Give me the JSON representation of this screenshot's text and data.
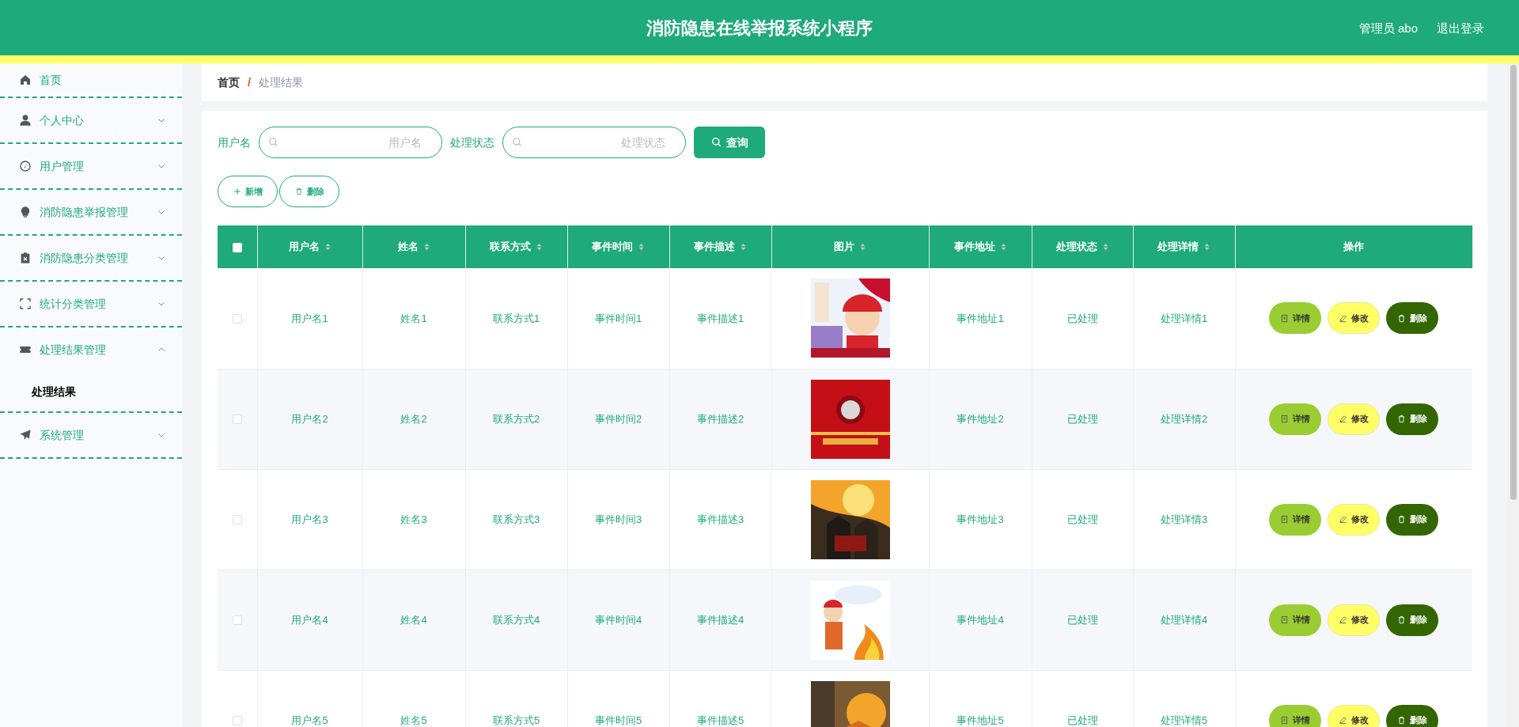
{
  "header": {
    "title": "消防隐患在线举报系统小程序",
    "user": "管理员 abo",
    "logout": "退出登录"
  },
  "sidebar": {
    "items": [
      {
        "label": "首页"
      },
      {
        "label": "个人中心",
        "expanded": false
      },
      {
        "label": "用户管理",
        "expanded": false
      },
      {
        "label": "消防隐患举报管理",
        "expanded": false
      },
      {
        "label": "消防隐患分类管理",
        "expanded": false
      },
      {
        "label": "统计分类管理",
        "expanded": false
      },
      {
        "label": "处理结果管理",
        "expanded": true,
        "children": [
          {
            "label": "处理结果",
            "selected": true
          }
        ]
      },
      {
        "label": "系统管理",
        "expanded": false
      }
    ]
  },
  "breadcrumb": {
    "items": [
      "首页",
      "处理结果"
    ],
    "separator": "/"
  },
  "search": {
    "fields": [
      {
        "label": "用户名",
        "placeholder": "用户名"
      },
      {
        "label": "处理状态",
        "placeholder": "处理状态"
      }
    ],
    "button": "查询"
  },
  "actions": [
    {
      "kind": "add",
      "label": "新增"
    },
    {
      "kind": "delete",
      "label": "删除"
    }
  ],
  "table": {
    "select_all": {
      "checked": false
    },
    "columns": [
      {
        "label": "用户名",
        "sortable": true
      },
      {
        "label": "姓名",
        "sortable": true
      },
      {
        "label": "联系方式",
        "sortable": true
      },
      {
        "label": "事件时间",
        "sortable": true
      },
      {
        "label": "事件描述",
        "sortable": true
      },
      {
        "label": "图片",
        "sortable": true
      },
      {
        "label": "事件地址",
        "sortable": true
      },
      {
        "label": "处理状态",
        "sortable": true
      },
      {
        "label": "处理详情",
        "sortable": true
      },
      {
        "label": "操作",
        "sortable": false
      }
    ],
    "rows": [
      {
        "checked": false,
        "cells": [
          "用户名1",
          "姓名1",
          "联系方式1",
          "事件时间1",
          "事件描述1",
          {
            "kind": "picture"
          },
          "事件地址1",
          "已处理",
          "处理详情1"
        ],
        "buttons": [
          {
            "kind": "detail",
            "label": "详情"
          },
          {
            "kind": "edit",
            "label": "修改"
          },
          {
            "kind": "delete",
            "label": "删除"
          }
        ]
      },
      {
        "checked": false,
        "cells": [
          "用户名2",
          "姓名2",
          "联系方式2",
          "事件时间2",
          "事件描述2",
          {
            "kind": "picture"
          },
          "事件地址2",
          "已处理",
          "处理详情2"
        ],
        "buttons": [
          {
            "kind": "detail",
            "label": "详情"
          },
          {
            "kind": "edit",
            "label": "修改"
          },
          {
            "kind": "delete",
            "label": "删除"
          }
        ]
      },
      {
        "checked": false,
        "cells": [
          "用户名3",
          "姓名3",
          "联系方式3",
          "事件时间3",
          "事件描述3",
          {
            "kind": "picture"
          },
          "事件地址3",
          "已处理",
          "处理详情3"
        ],
        "buttons": [
          {
            "kind": "detail",
            "label": "详情"
          },
          {
            "kind": "edit",
            "label": "修改"
          },
          {
            "kind": "delete",
            "label": "删除"
          }
        ]
      },
      {
        "checked": false,
        "cells": [
          "用户名4",
          "姓名4",
          "联系方式4",
          "事件时间4",
          "事件描述4",
          {
            "kind": "picture"
          },
          "事件地址4",
          "已处理",
          "处理详情4"
        ],
        "buttons": [
          {
            "kind": "detail",
            "label": "详情"
          },
          {
            "kind": "edit",
            "label": "修改"
          },
          {
            "kind": "delete",
            "label": "删除"
          }
        ]
      },
      {
        "checked": false,
        "cells": [
          "用户名5",
          "姓名5",
          "联系方式5",
          "事件时间5",
          "事件描述5",
          {
            "kind": "picture"
          },
          "事件地址5",
          "已处理",
          "处理详情5"
        ],
        "buttons": [
          {
            "kind": "detail",
            "label": "详情"
          },
          {
            "kind": "edit",
            "label": "修改"
          },
          {
            "kind": "delete",
            "label": "删除"
          }
        ]
      }
    ]
  }
}
